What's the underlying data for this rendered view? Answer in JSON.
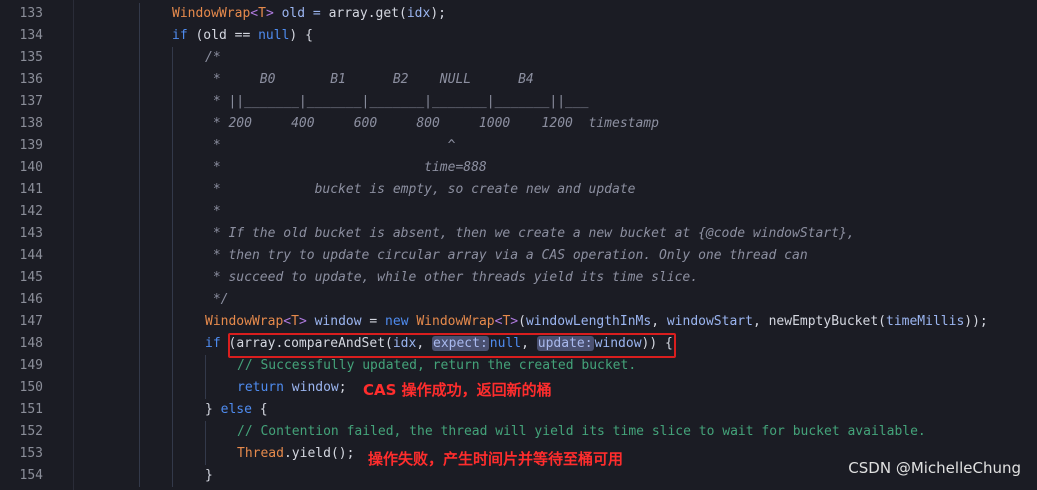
{
  "lines": [
    {
      "num": "133"
    },
    {
      "num": "134"
    },
    {
      "num": "135"
    },
    {
      "num": "136"
    },
    {
      "num": "137"
    },
    {
      "num": "138"
    },
    {
      "num": "139"
    },
    {
      "num": "140"
    },
    {
      "num": "141"
    },
    {
      "num": "142"
    },
    {
      "num": "143"
    },
    {
      "num": "144"
    },
    {
      "num": "145"
    },
    {
      "num": "146"
    },
    {
      "num": "147"
    },
    {
      "num": "148"
    },
    {
      "num": "149"
    },
    {
      "num": "150"
    },
    {
      "num": "151"
    },
    {
      "num": "152"
    },
    {
      "num": "153"
    },
    {
      "num": "154"
    }
  ],
  "t": {
    "windowwrap": "WindowWrap",
    "typeparam_open": "<",
    "typeparam_T": "T",
    "typeparam_close": ">",
    "l133_old": " old = ",
    "l133_array": "array",
    "l133_get": ".get(",
    "l133_idx": "idx",
    "l133_end": ");",
    "kw_if": "if",
    "l134_mid": " (old == ",
    "kw_null": "null",
    "l134_end": ") {",
    "c135": "/*",
    "c136": " *     B0       B1      B2    NULL      B4",
    "c137": " * ||_______|_______|_______|_______|_______||___",
    "c138": " * 200     400     600     800     1000    1200  timestamp",
    "c139": " *                             ^",
    "c140": " *                          time=888",
    "c141": " *            bucket is empty, so create new and update",
    "c142": " *",
    "c143": " * If the old bucket is absent, then we create a new bucket at {@code windowStart},",
    "c144": " * then try to update circular array via a CAS operation. Only one thread can",
    "c145": " * succeed to update, while other threads yield its time slice.",
    "c146": " */",
    "l147_window": " window",
    "l147_eq": " = ",
    "kw_new": "new",
    "l147_sp": " ",
    "l147_open": "(",
    "l147_wlen": "windowLengthInMs",
    "l147_comma": ", ",
    "l147_wstart": "windowStart",
    "l147_neb": "newEmptyBucket",
    "l147_tm": "timeMillis",
    "l147_end": "));",
    "l148_open": " (",
    "l148_array": "array",
    "l148_cas": ".compareAndSet(",
    "l148_idx": "idx",
    "l148_comma": ", ",
    "hint_expect": "expect:",
    "hint_update": "update:",
    "l148_window": "window",
    "l148_end": ")) {",
    "c149": "// Successfully updated, return the created bucket.",
    "kw_return": "return",
    "l150_window": " window",
    "l150_end": ";",
    "l151_close": "} ",
    "kw_else": "else",
    "l151_open": " {",
    "c152": "// Contention failed, the thread will yield its time slice to wait for bucket available.",
    "l153_thread": "Thread",
    "l153_yield": ".yield",
    "l153_end": "();",
    "l154": "}"
  },
  "annotations": {
    "cas_success": "CAS 操作成功，返回新的桶",
    "cas_fail": "操作失败，产生时间片并等待至桶可用"
  },
  "watermark": "CSDN @MichelleChung"
}
